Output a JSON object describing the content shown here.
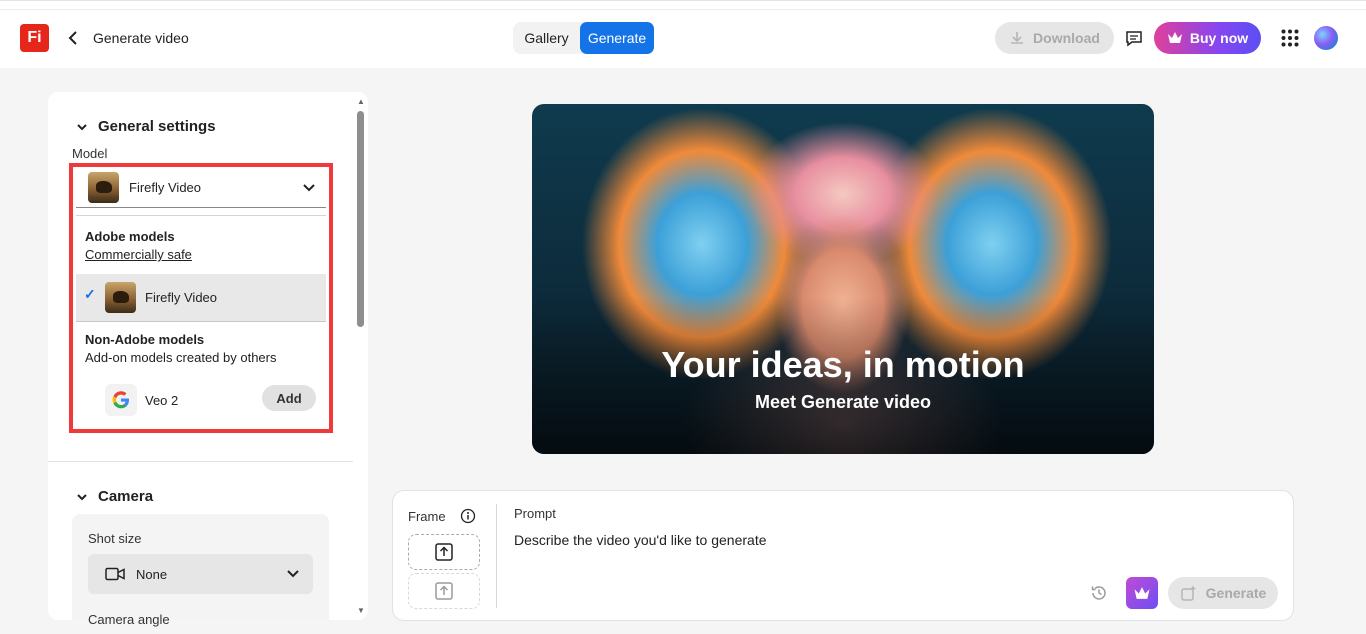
{
  "header": {
    "logo_text": "Fi",
    "page_title": "Generate video",
    "tabs": [
      {
        "label": "Gallery",
        "active": false
      },
      {
        "label": "Generate",
        "active": true
      }
    ],
    "download_label": "Download",
    "buy_label": "Buy now",
    "accent_color": "#1473e6"
  },
  "settings": {
    "general_title": "General settings",
    "model_label": "Model",
    "model_selected": "Firefly Video",
    "dropdown": {
      "adobe_heading": "Adobe models",
      "adobe_sub": "Commercially safe",
      "adobe_items": [
        {
          "label": "Firefly Video",
          "selected": true
        }
      ],
      "non_adobe_heading": "Non-Adobe models",
      "non_adobe_sub": "Add-on models created by others",
      "non_adobe_items": [
        {
          "label": "Veo 2",
          "action": "Add"
        }
      ]
    },
    "camera_title": "Camera",
    "shot_size_label": "Shot size",
    "shot_size_value": "None",
    "camera_angle_label": "Camera angle"
  },
  "hero": {
    "title": "Your ideas, in motion",
    "subtitle": "Meet Generate video"
  },
  "prompt": {
    "frame_label": "Frame",
    "prompt_label": "Prompt",
    "placeholder": "Describe the video you'd like to generate",
    "generate_label": "Generate"
  },
  "icons": [
    "back-chevron-icon",
    "download-icon",
    "comment-icon",
    "crown-icon",
    "apps-grid-icon",
    "chevron-down-icon",
    "checkmark-icon",
    "google-icon",
    "video-camera-icon",
    "info-icon",
    "upload-icon",
    "history-icon"
  ]
}
